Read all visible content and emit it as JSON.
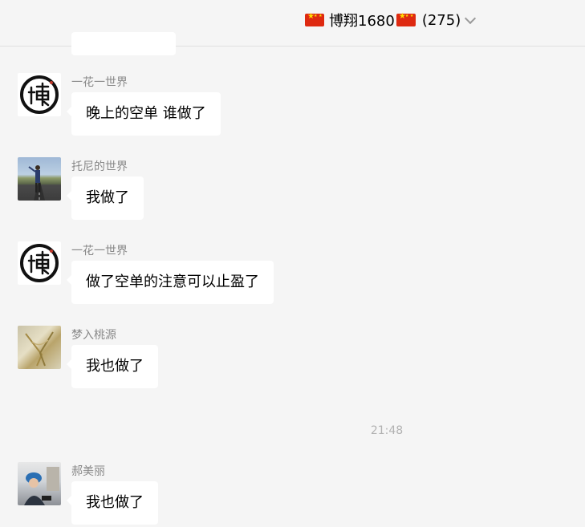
{
  "header": {
    "title": "博翔1680",
    "member_count": "(275)"
  },
  "messages": [
    {
      "sender": "一花一世界",
      "text": "晚上的空单  谁做了",
      "avatar": "bo-calligraphy-icon"
    },
    {
      "sender": "托尼的世界",
      "text": "我做了",
      "avatar": "road-photo"
    },
    {
      "sender": "一花一世界",
      "text": "做了空单的注意可以止盈了",
      "avatar": "bo-calligraphy-icon"
    },
    {
      "sender": "梦入桃源",
      "text": "我也做了",
      "avatar": "art-photo"
    },
    {
      "sender": "郝美丽",
      "text": "我也做了",
      "avatar": "portrait-photo"
    }
  ],
  "timestamp": "21:48",
  "colors": {
    "background": "#f5f5f5",
    "bubble": "#ffffff",
    "sender_text": "#888888",
    "timestamp_text": "#b2b2b2",
    "flag_red": "#de2910",
    "flag_star": "#ffde00"
  }
}
